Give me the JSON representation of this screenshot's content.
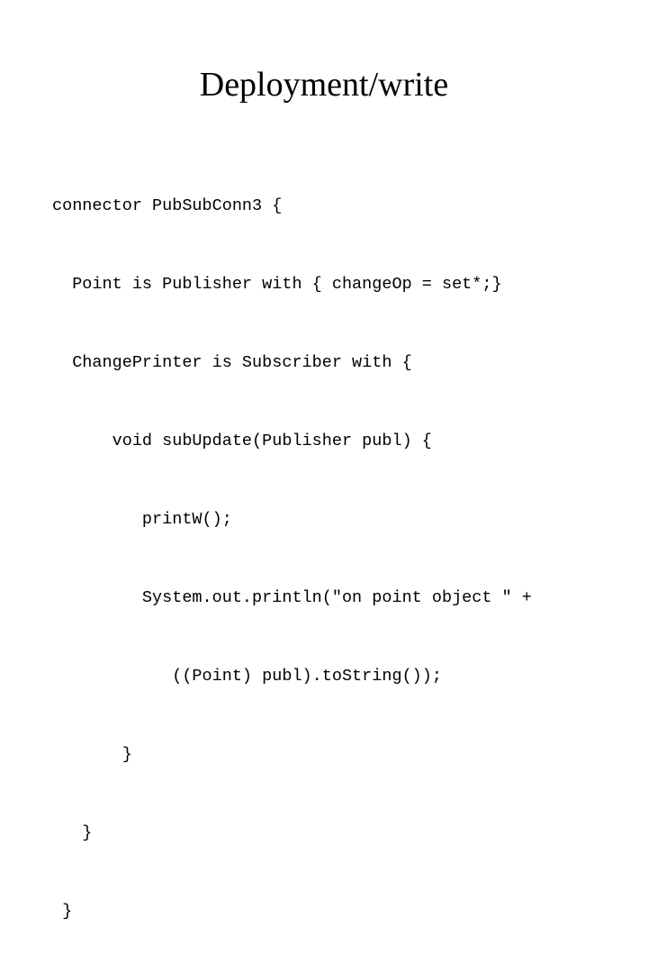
{
  "slide": {
    "title": "Deployment/write",
    "background_color": "#ffffff",
    "text_color": "#000000",
    "code": {
      "language": "java-like",
      "lines": [
        "connector PubSubConn3 {",
        "  Point is Publisher with { changeOp = set*;}",
        "  ChangePrinter is Subscriber with {",
        "      void subUpdate(Publisher publ) {",
        "         printW();",
        "         System.out.println(\"on point object \" +",
        "            ((Point) publ).toString());",
        "       }",
        "   }",
        " }"
      ]
    }
  }
}
